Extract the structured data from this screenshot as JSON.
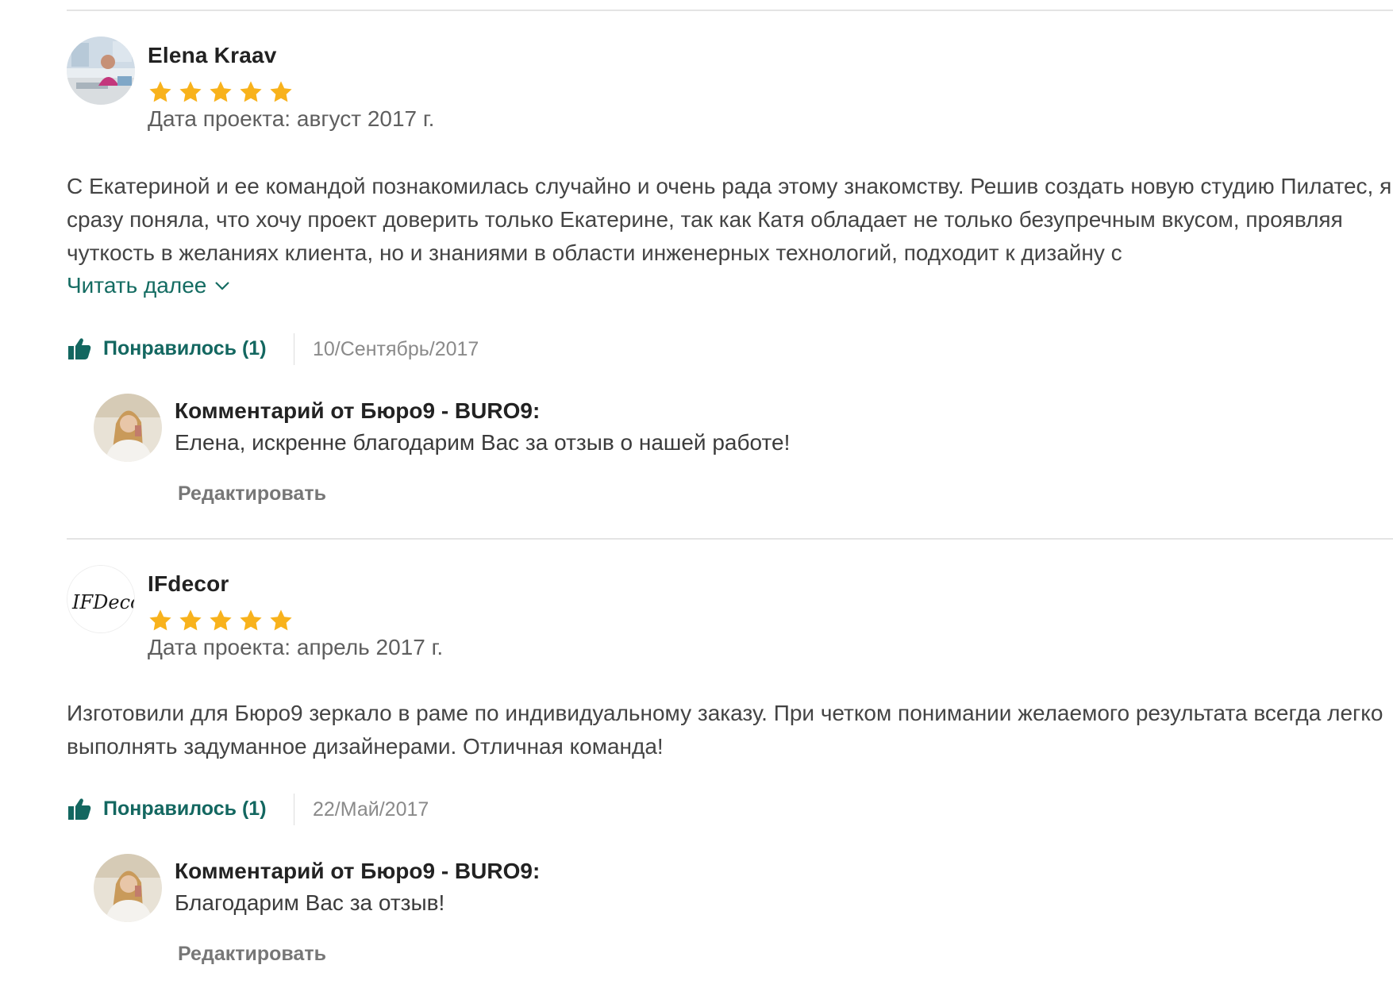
{
  "colors": {
    "star": "#f8b21c",
    "accent_green": "#136760",
    "divider": "#e4e4e4"
  },
  "reviews": [
    {
      "author": "Elena Kraav",
      "rating": 5,
      "project_date": "Дата проекта: август 2017 г.",
      "text": "С Екатериной и ее командой познакомилась случайно и очень рада этому знакомству. Решив создать новую студию Пилатес, я сразу поняла, что хочу проект доверить только Екатерине, так как Катя обладает не только безупречным вкусом, проявляя чуткость в желаниях клиента, но и знаниями в области инженерных технологий, подходит к дизайну с",
      "read_more": "Читать далее",
      "likes": "Понравилось (1)",
      "date": "10/Сентябрь/2017",
      "comment": {
        "title": "Комментарий от Бюро9 - BURO9:",
        "text": "Елена, искренне благодарим Вас за отзыв о нашей работе!",
        "edit": "Редактировать"
      }
    },
    {
      "author": "IFdecor",
      "logo_text": "IFDecor",
      "rating": 5,
      "project_date": "Дата проекта: апрель 2017 г.",
      "text": "Изготовили для Бюро9 зеркало в раме по индивидуальному заказу. При четком понимании желаемого результата всегда легко выполнять задуманное дизайнерами. Отличная команда!",
      "likes": "Понравилось (1)",
      "date": "22/Май/2017",
      "comment": {
        "title": "Комментарий от Бюро9 - BURO9:",
        "text": "Благодарим Вас за отзыв!",
        "edit": "Редактировать"
      }
    }
  ],
  "icons": {
    "star": "star-icon",
    "like": "thumbs-up-icon",
    "chevron": "chevron-down-icon"
  }
}
